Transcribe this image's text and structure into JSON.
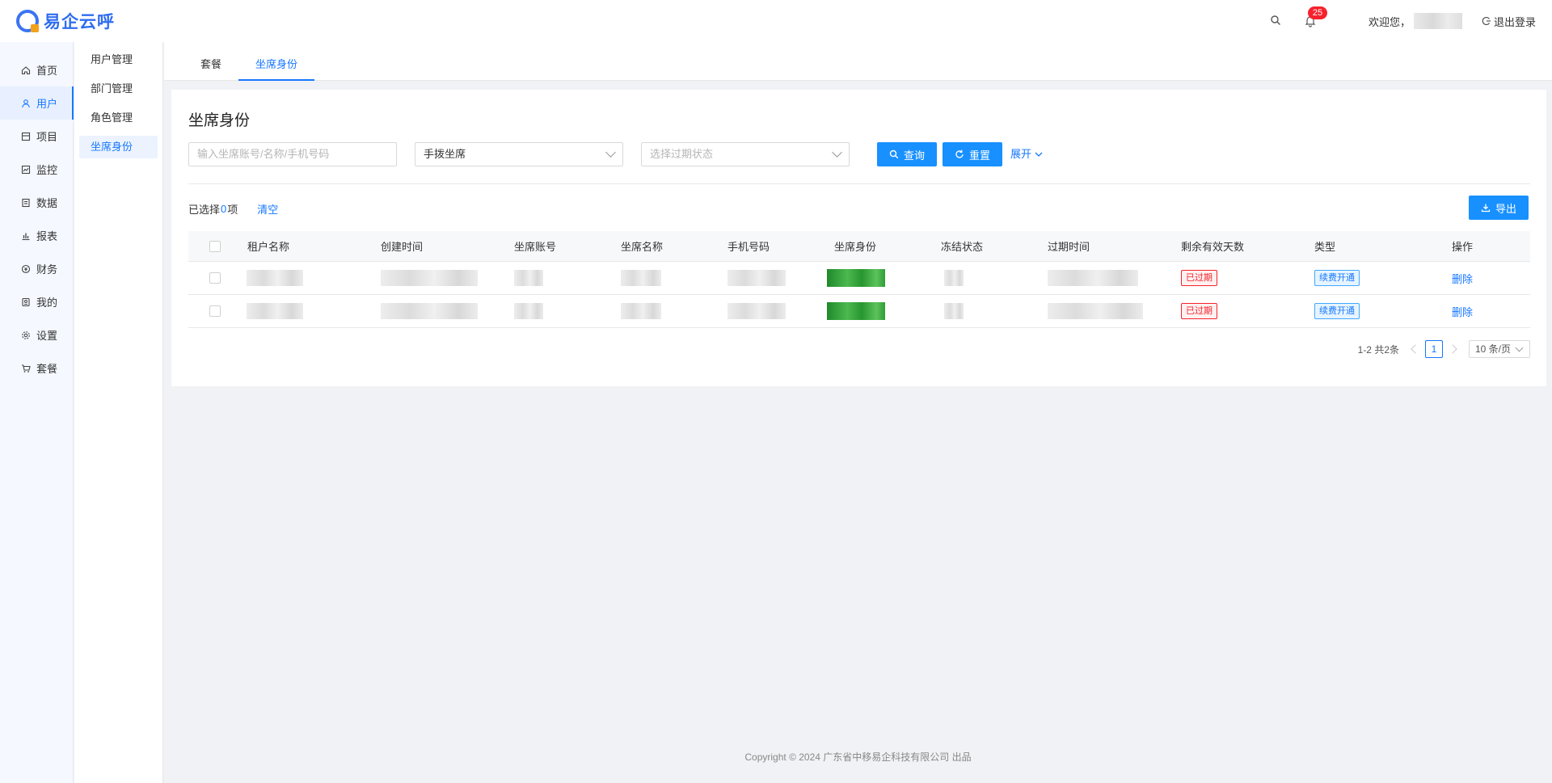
{
  "app": {
    "name": "易企云呼"
  },
  "header": {
    "notification_count": "25",
    "welcome": "欢迎您，",
    "logout": "退出登录"
  },
  "nav": {
    "items": [
      {
        "label": "首页",
        "icon": "home-icon"
      },
      {
        "label": "用户",
        "icon": "user-icon",
        "active": true
      },
      {
        "label": "项目",
        "icon": "project-icon"
      },
      {
        "label": "监控",
        "icon": "monitor-icon"
      },
      {
        "label": "数据",
        "icon": "data-icon"
      },
      {
        "label": "报表",
        "icon": "report-icon"
      },
      {
        "label": "财务",
        "icon": "finance-icon"
      },
      {
        "label": "我的",
        "icon": "mine-icon"
      },
      {
        "label": "设置",
        "icon": "settings-icon"
      },
      {
        "label": "套餐",
        "icon": "cart-icon"
      }
    ]
  },
  "subnav": {
    "items": [
      {
        "label": "用户管理"
      },
      {
        "label": "部门管理"
      },
      {
        "label": "角色管理"
      },
      {
        "label": "坐席身份",
        "active": true
      }
    ]
  },
  "tabs": [
    {
      "label": "套餐"
    },
    {
      "label": "坐席身份",
      "active": true
    }
  ],
  "page": {
    "title": "坐席身份",
    "search_placeholder": "输入坐席账号/名称/手机号码",
    "type_select_value": "手拨坐席",
    "expiry_select_placeholder": "选择过期状态",
    "query_button": "查询",
    "reset_button": "重置",
    "expand_link": "展开",
    "selected_prefix": "已选择",
    "selected_count": "0",
    "selected_suffix": "项",
    "clear_link": "清空",
    "export_button": "导出"
  },
  "table": {
    "columns": [
      "租户名称",
      "创建时间",
      "坐席账号",
      "坐席名称",
      "手机号码",
      "坐席身份",
      "冻结状态",
      "过期时间",
      "剩余有效天数",
      "类型",
      "操作"
    ],
    "rows": [
      {
        "remaining_days": "已过期",
        "type": "续费开通",
        "action": "删除"
      },
      {
        "remaining_days": "已过期",
        "type": "续费开通",
        "action": "删除"
      }
    ]
  },
  "pagination": {
    "summary": "1-2 共2条",
    "current_page": "1",
    "page_size": "10 条/页"
  },
  "footer": {
    "copyright": "Copyright © 2024 广东省中移易企科技有限公司 出品"
  },
  "colors": {
    "primary": "#1890ff",
    "danger": "#f5222d",
    "brand": "#2f6df0"
  }
}
